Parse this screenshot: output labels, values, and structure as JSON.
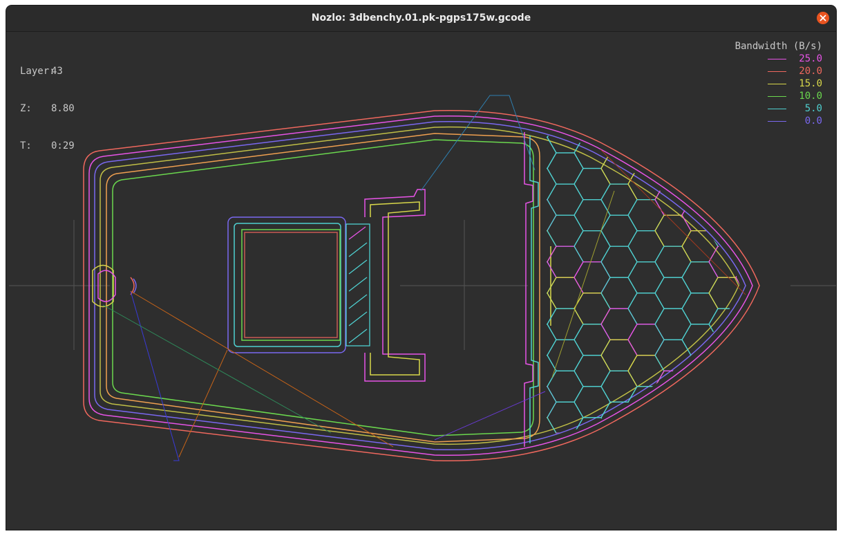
{
  "window": {
    "title": "Nozlo: 3dbenchy.01.pk-pgps175w.gcode",
    "close_icon": "close-icon",
    "close_color": "#e95420"
  },
  "info": {
    "layer_label": "Layer:",
    "layer_value": "43",
    "z_label": "Z:",
    "z_value": "8.80",
    "t_label": "T:",
    "t_value": "0:29"
  },
  "legend": {
    "title": "Bandwidth (B/s)",
    "entries": [
      {
        "value": "25.0",
        "color": "#e754e7"
      },
      {
        "value": "20.0",
        "color": "#f0685e"
      },
      {
        "value": "15.0",
        "color": "#d9d84a"
      },
      {
        "value": "10.0",
        "color": "#6bd84e"
      },
      {
        "value": "5.0",
        "color": "#4fd0d0"
      },
      {
        "value": "0.0",
        "color": "#7a68f0"
      }
    ]
  },
  "colors": {
    "background": "#2e2e2e",
    "crosshair": "#555555"
  }
}
